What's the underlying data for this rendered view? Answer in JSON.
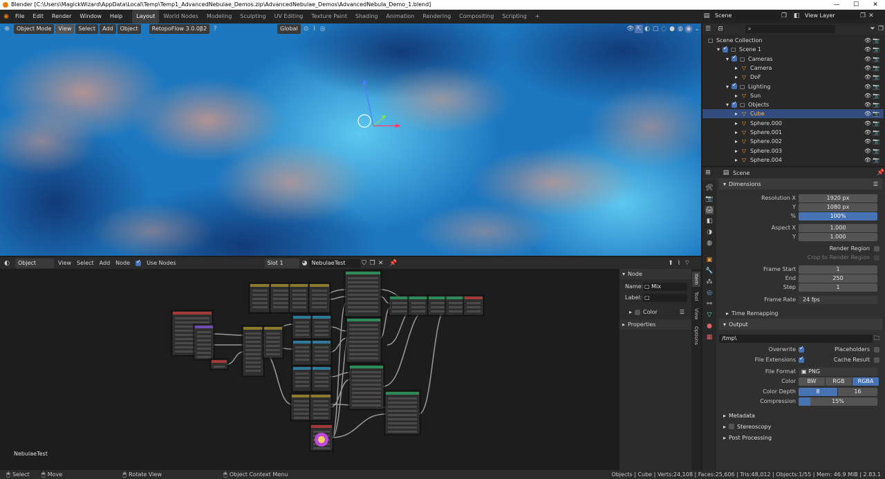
{
  "titlebar": {
    "title": "Blender [C:\\Users\\MagickWizard\\AppData\\Local\\Temp\\Temp1_AdvancedNebulae_Demos.zip\\AdvancedNebulae_Demos\\AdvancedNebula_Demo_1.blend]",
    "minimize": "—",
    "maximize": "☐",
    "close": "✕"
  },
  "menu": [
    "File",
    "Edit",
    "Render",
    "Window",
    "Help"
  ],
  "workspaces": [
    "Layout",
    "World Nodes",
    "Modeling",
    "Sculpting",
    "UV Editing",
    "Texture Paint",
    "Shading",
    "Animation",
    "Rendering",
    "Compositing",
    "Scripting"
  ],
  "workspace_add": "+",
  "top_right": {
    "scene": "Scene",
    "view_layer": "View Layer"
  },
  "viewport_header": {
    "mode": "Object Mode",
    "view": "View",
    "select": "Select",
    "add": "Add",
    "object": "Object",
    "addon": "RetopoFlow 3.0.0β2",
    "help": "?",
    "orientation": "Global"
  },
  "outliner": {
    "search_placeholder": "",
    "rows": [
      {
        "label": "Scene Collection",
        "indent": 0
      },
      {
        "label": "Scene 1",
        "indent": 1
      },
      {
        "label": "Cameras",
        "indent": 2
      },
      {
        "label": "Camera",
        "indent": 3
      },
      {
        "label": "DoF",
        "indent": 3
      },
      {
        "label": "Lighting",
        "indent": 2
      },
      {
        "label": "Sun",
        "indent": 3
      },
      {
        "label": "Objects",
        "indent": 2
      },
      {
        "label": "Cube",
        "indent": 3,
        "selected": true
      },
      {
        "label": "Sphere.000",
        "indent": 3
      },
      {
        "label": "Sphere.001",
        "indent": 3
      },
      {
        "label": "Sphere.002",
        "indent": 3
      },
      {
        "label": "Sphere.003",
        "indent": 3
      },
      {
        "label": "Sphere.004",
        "indent": 3
      }
    ]
  },
  "properties": {
    "breadcrumb": "Scene",
    "dimensions": {
      "title": "Dimensions",
      "res_x_label": "Resolution X",
      "res_x": "1920 px",
      "res_y_label": "Y",
      "res_y": "1080 px",
      "pct_label": "%",
      "pct": "100%",
      "aspect_x_label": "Aspect X",
      "aspect_x": "1.000",
      "aspect_y_label": "Y",
      "aspect_y": "1.000",
      "render_region": "Render Region",
      "crop_region": "Crop to Render Region",
      "frame_start_label": "Frame Start",
      "frame_start": "1",
      "end_label": "End",
      "end": "250",
      "step_label": "Step",
      "step": "1",
      "frame_rate_label": "Frame Rate",
      "frame_rate": "24 fps",
      "time_remapping": "Time Remapping"
    },
    "output": {
      "title": "Output",
      "path": "/tmp\\",
      "overwrite": "Overwrite",
      "placeholders": "Placeholders",
      "file_ext": "File Extensions",
      "cache_result": "Cache Result",
      "file_format_label": "File Format",
      "file_format": "PNG",
      "color_label": "Color",
      "color_opts": [
        "BW",
        "RGB",
        "RGBA"
      ],
      "color_depth_label": "Color Depth",
      "depth_opts": [
        "8",
        "16"
      ],
      "compression_label": "Compression",
      "compression": "15%",
      "compression_fraction": 0.15
    },
    "metadata": "Metadata",
    "stereoscopy": "Stereoscopy",
    "post_processing": "Post Processing"
  },
  "node_editor": {
    "header": {
      "type": "Object",
      "view": "View",
      "select": "Select",
      "add": "Add",
      "node": "Node",
      "use_nodes": "Use Nodes",
      "slot": "Slot 1",
      "material": "NebulaeTest"
    },
    "material_label": "NebulaeTest",
    "sidebar": {
      "title": "Node",
      "name_label": "Name:",
      "name": "Mix",
      "label_label": "Label:",
      "label": "",
      "color": "Color",
      "properties": "Properties",
      "tabs": [
        "Item",
        "Tool",
        "View",
        "Options"
      ]
    }
  },
  "statusbar": {
    "select": "Select",
    "move": "Move",
    "rotate": "Rotate View",
    "context": "Object Context Menu",
    "stats": "Objects | Cube | Verts:24,108 | Faces:25,606 | Tris:48,012 | Objects:1/55 | Mem: 46.9 MiB | 2.83.1"
  }
}
